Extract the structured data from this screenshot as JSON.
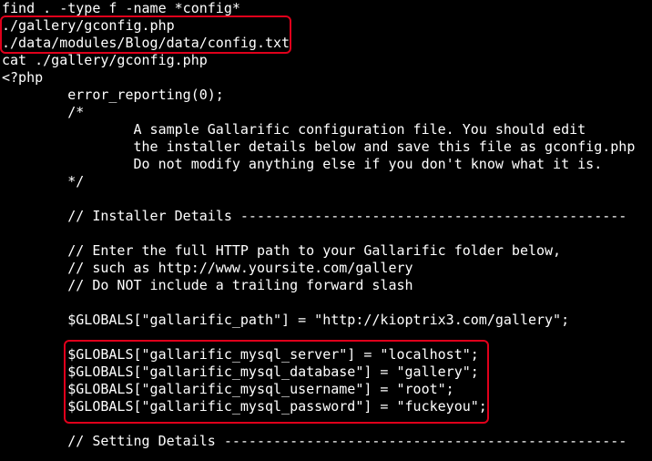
{
  "terminal": {
    "lines": [
      "find . -type f -name *config*",
      "./gallery/gconfig.php",
      "./data/modules/Blog/data/config.txt",
      "cat ./gallery/gconfig.php",
      "<?php",
      "        error_reporting(0);",
      "        /*",
      "                A sample Gallarific configuration file. You should edit",
      "                the installer details below and save this file as gconfig.php",
      "                Do not modify anything else if you don't know what it is.",
      "        */",
      "",
      "        // Installer Details -----------------------------------------------",
      "",
      "        // Enter the full HTTP path to your Gallarific folder below,",
      "        // such as http://www.yoursite.com/gallery",
      "        // Do NOT include a trailing forward slash",
      "",
      "        $GLOBALS[\"gallarific_path\"] = \"http://kioptrix3.com/gallery\";",
      "",
      "        $GLOBALS[\"gallarific_mysql_server\"] = \"localhost\";",
      "        $GLOBALS[\"gallarific_mysql_database\"] = \"gallery\";",
      "        $GLOBALS[\"gallarific_mysql_username\"] = \"root\";",
      "        $GLOBALS[\"gallarific_mysql_password\"] = \"fuckeyou\";",
      "",
      "        // Setting Details -------------------------------------------------"
    ]
  },
  "colors": {
    "background": "#000000",
    "text": "#ffffff",
    "highlight": "#e0001b"
  }
}
